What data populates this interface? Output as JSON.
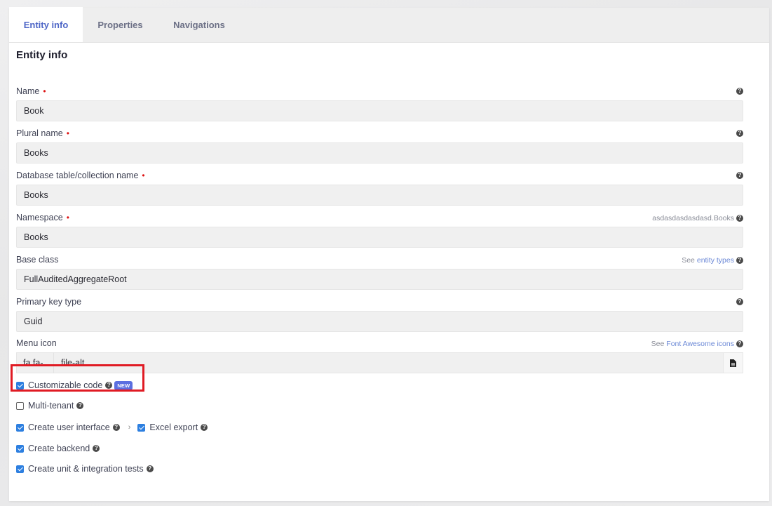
{
  "tabs": [
    {
      "label": "Entity info",
      "active": true
    },
    {
      "label": "Properties",
      "active": false
    },
    {
      "label": "Navigations",
      "active": false
    }
  ],
  "section_title": "Entity info",
  "fields": {
    "name": {
      "label": "Name",
      "value": "Book"
    },
    "plural": {
      "label": "Plural name",
      "value": "Books"
    },
    "table": {
      "label": "Database table/collection name",
      "value": "Books"
    },
    "namespace": {
      "label": "Namespace",
      "value": "Books",
      "hint": "asdasdasdasdasd.Books"
    },
    "base_class": {
      "label": "Base class",
      "value": "FullAuditedAggregateRoot",
      "hint_prefix": "See",
      "hint_link": "entity types"
    },
    "pk_type": {
      "label": "Primary key type",
      "value": "Guid"
    },
    "menu_icon": {
      "label": "Menu icon",
      "prefix": "fa fa-",
      "value": "file-alt",
      "hint_prefix": "See",
      "hint_link": "Font Awesome icons"
    }
  },
  "required_marker": "•",
  "help_glyph": "?",
  "checkboxes": {
    "customizable": {
      "label": "Customizable code",
      "checked": true,
      "badge": "NEW"
    },
    "multi_tenant": {
      "label": "Multi-tenant",
      "checked": false
    },
    "create_ui": {
      "label": "Create user interface",
      "checked": true
    },
    "excel_export": {
      "label": "Excel export",
      "checked": true
    },
    "create_backend": {
      "label": "Create backend",
      "checked": true
    },
    "create_tests": {
      "label": "Create unit & integration tests",
      "checked": true
    }
  },
  "colors": {
    "accent": "#4f67c7",
    "checkbox": "#2d7fe0",
    "highlight": "#e01b24",
    "badge": "#5b6fe0",
    "required": "#dd1111"
  },
  "icons": {
    "help": "question-circle-icon",
    "file": "file-alt-icon",
    "chevron": "chevron-right-icon"
  }
}
